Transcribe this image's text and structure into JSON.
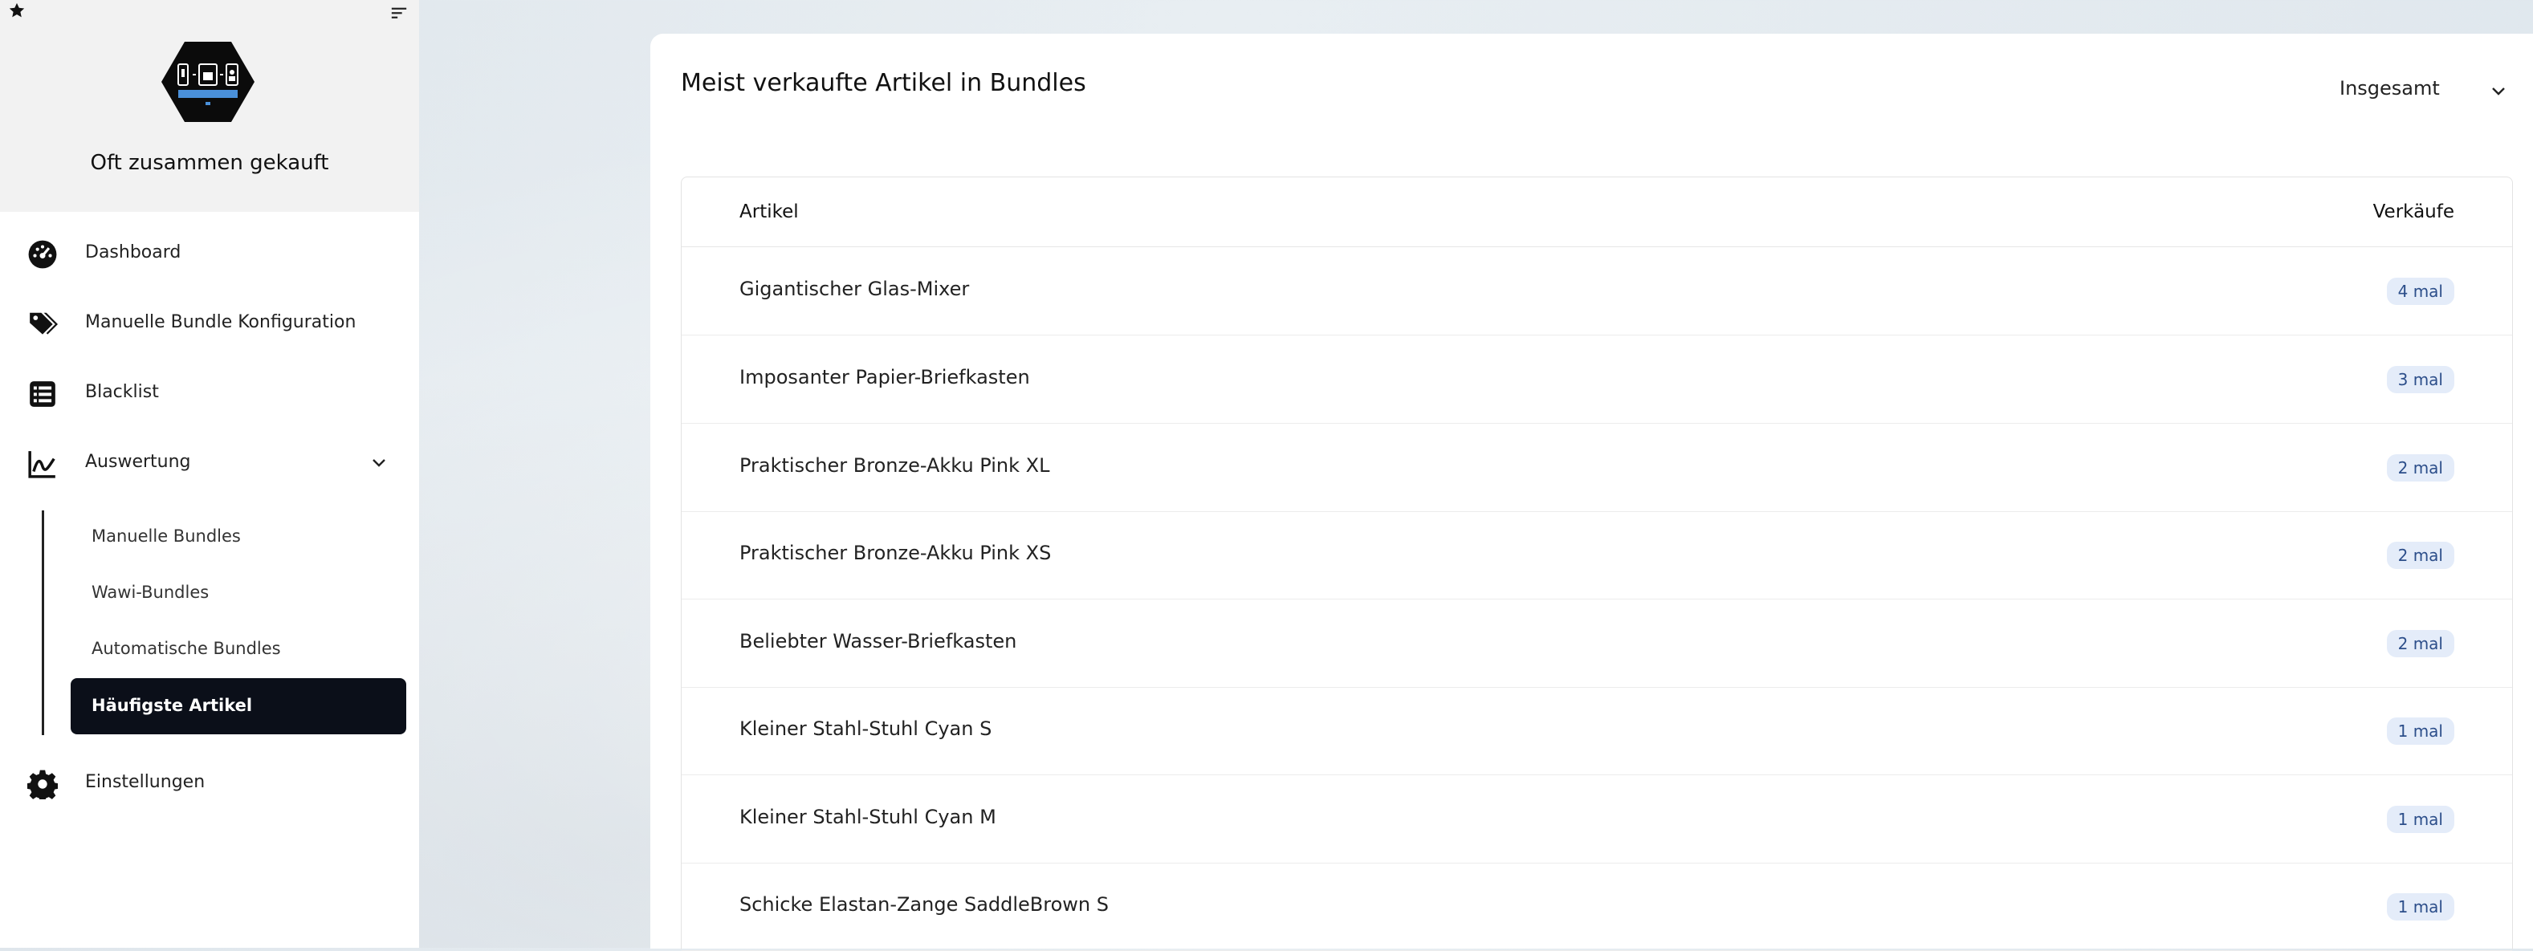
{
  "app": {
    "title": "Oft zusammen gekauft"
  },
  "sidebar": {
    "items": [
      {
        "label": "Dashboard",
        "icon": "dashboard-gauge-icon"
      },
      {
        "label": "Manuelle Bundle Konfiguration",
        "icon": "tags-icon"
      },
      {
        "label": "Blacklist",
        "icon": "list-icon"
      },
      {
        "label": "Auswertung",
        "icon": "chart-line-icon",
        "expanded": true
      },
      {
        "label": "Einstellungen",
        "icon": "gear-icon"
      }
    ],
    "subitems": [
      {
        "label": "Manuelle Bundles"
      },
      {
        "label": "Wawi-Bundles"
      },
      {
        "label": "Automatische Bundles"
      },
      {
        "label": "Häufigste Artikel",
        "active": true
      }
    ]
  },
  "main": {
    "title": "Meist verkaufte Artikel in Bundles",
    "period_select": {
      "value": "Insgesamt"
    },
    "table": {
      "columns": [
        "Artikel",
        "Verkäufe"
      ],
      "rows": [
        {
          "name": "Gigantischer Glas-Mixer",
          "sales": "4 mal"
        },
        {
          "name": "Imposanter Papier-Briefkasten",
          "sales": "3 mal"
        },
        {
          "name": "Praktischer Bronze-Akku Pink XL",
          "sales": "2 mal"
        },
        {
          "name": "Praktischer Bronze-Akku Pink XS",
          "sales": "2 mal"
        },
        {
          "name": "Beliebter Wasser-Briefkasten",
          "sales": "2 mal"
        },
        {
          "name": "Kleiner Stahl-Stuhl Cyan S",
          "sales": "1 mal"
        },
        {
          "name": "Kleiner Stahl-Stuhl Cyan M",
          "sales": "1 mal"
        },
        {
          "name": "Schicke Elastan-Zange SaddleBrown S",
          "sales": "1 mal"
        }
      ]
    }
  },
  "colors": {
    "active_nav_bg": "#0b0f19",
    "badge_bg": "#e4ecf9",
    "badge_text": "#2c4e8a",
    "logo_blue": "#4a90d9"
  }
}
